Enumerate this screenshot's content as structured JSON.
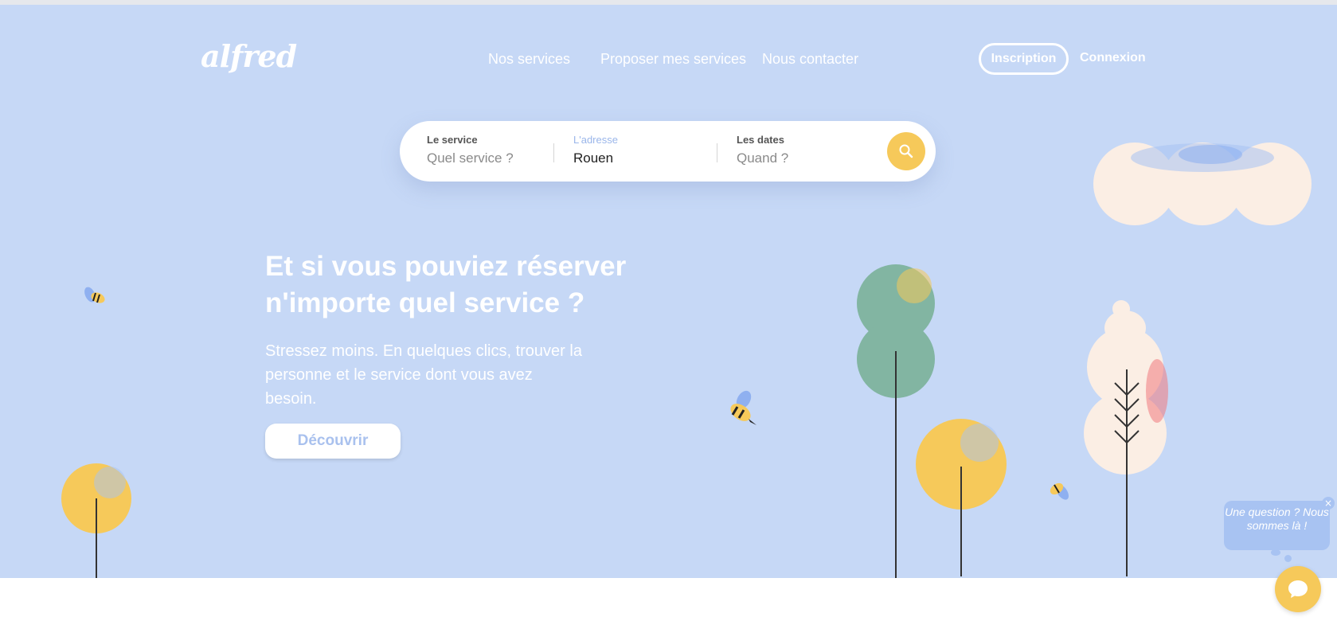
{
  "header": {
    "logo": "alfred",
    "nav": [
      "Nos services",
      "Proposer mes services",
      "Nous contacter"
    ],
    "signup_label": "Inscription",
    "login_label": "Connexion"
  },
  "search": {
    "service_label": "Le service",
    "service_placeholder": "Quel service ?",
    "address_label": "L'adresse",
    "address_value": "Rouen",
    "dates_label": "Les dates",
    "dates_placeholder": "Quand ?",
    "search_icon": "search-icon"
  },
  "hero": {
    "title": "Et si vous pouviez réserver n'importe quel service ?",
    "subtitle": "Stressez moins. En quelques clics, trouver la personne et le service dont vous avez besoin.",
    "cta_label": "Découvrir"
  },
  "chat": {
    "bubble_text": "Une question ? Nous sommes là !",
    "close_label": "×",
    "icon": "chat-icon"
  },
  "colors": {
    "hero_bg": "#c6d8f6",
    "accent_yellow": "#f6c95a",
    "tree_green": "#82b5a2",
    "cloud_cream": "#fbeee4",
    "chat_blue": "#a8c3f2"
  }
}
